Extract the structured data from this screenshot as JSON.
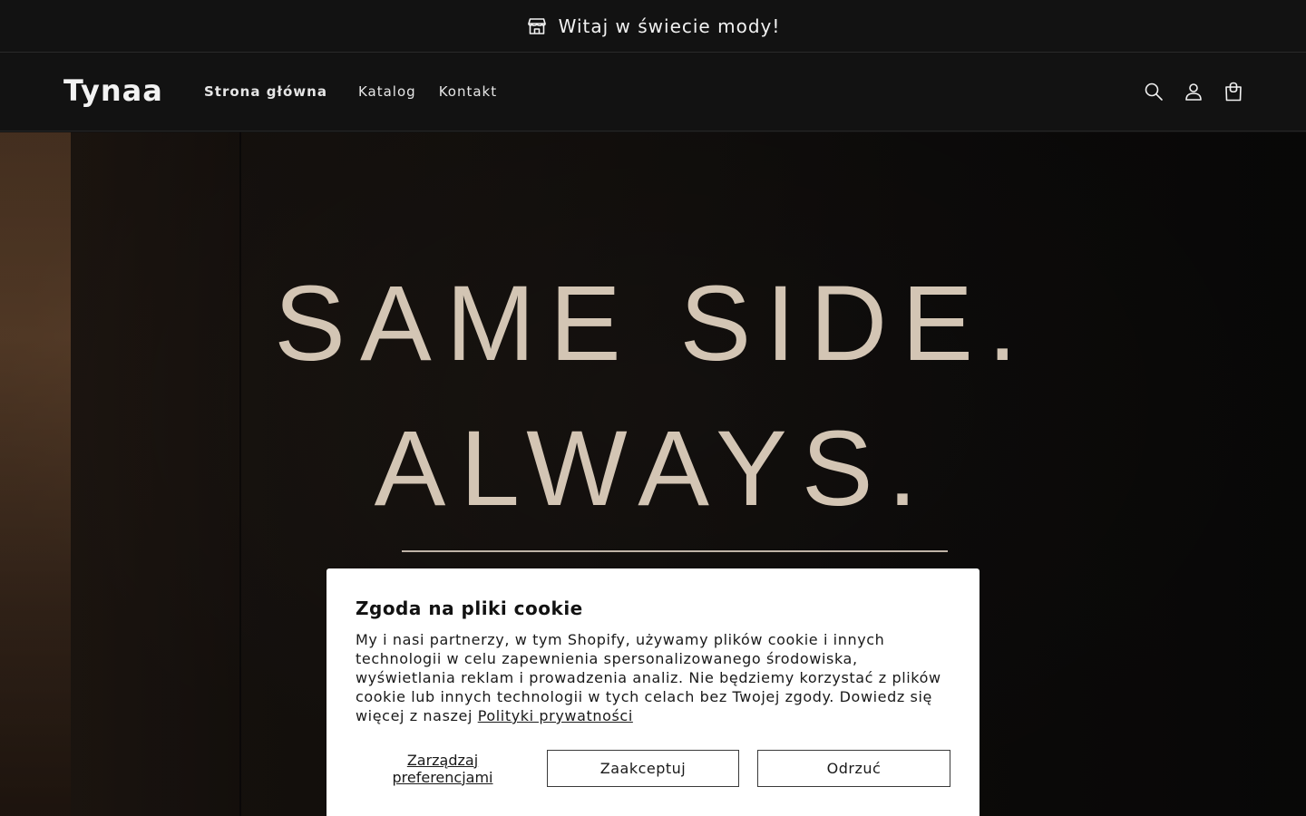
{
  "announcement": {
    "icon": "store-icon",
    "text": "Witaj w świecie mody!"
  },
  "header": {
    "logo": "Tynaa",
    "nav": [
      {
        "label": "Strona główna",
        "active": true
      },
      {
        "label": "Katalog",
        "active": false
      },
      {
        "label": "Kontakt",
        "active": false
      }
    ],
    "icons": [
      "search-icon",
      "account-icon",
      "cart-icon"
    ]
  },
  "hero": {
    "line1": "SAME SIDE.",
    "line2": "ALWAYS."
  },
  "cookie": {
    "title": "Zgoda na pliki cookie",
    "body": "My i nasi partnerzy, w tym Shopify, używamy plików cookie i innych technologii w celu zapewnienia spersonalizowanego środowiska, wyświetlania reklam i prowadzenia analiz. Nie będziemy korzystać z plików cookie lub innych technologii w tych celach bez Twojej zgody. Dowiedz się więcej z naszej ",
    "policy_link": "Polityki prywatności",
    "manage_label": "Zarządzaj preferencjami",
    "accept_label": "Zaakceptuj",
    "reject_label": "Odrzuć"
  },
  "colors": {
    "background": "#121212",
    "hero_text": "#d3c5b4",
    "dialog_bg": "#ffffff"
  }
}
